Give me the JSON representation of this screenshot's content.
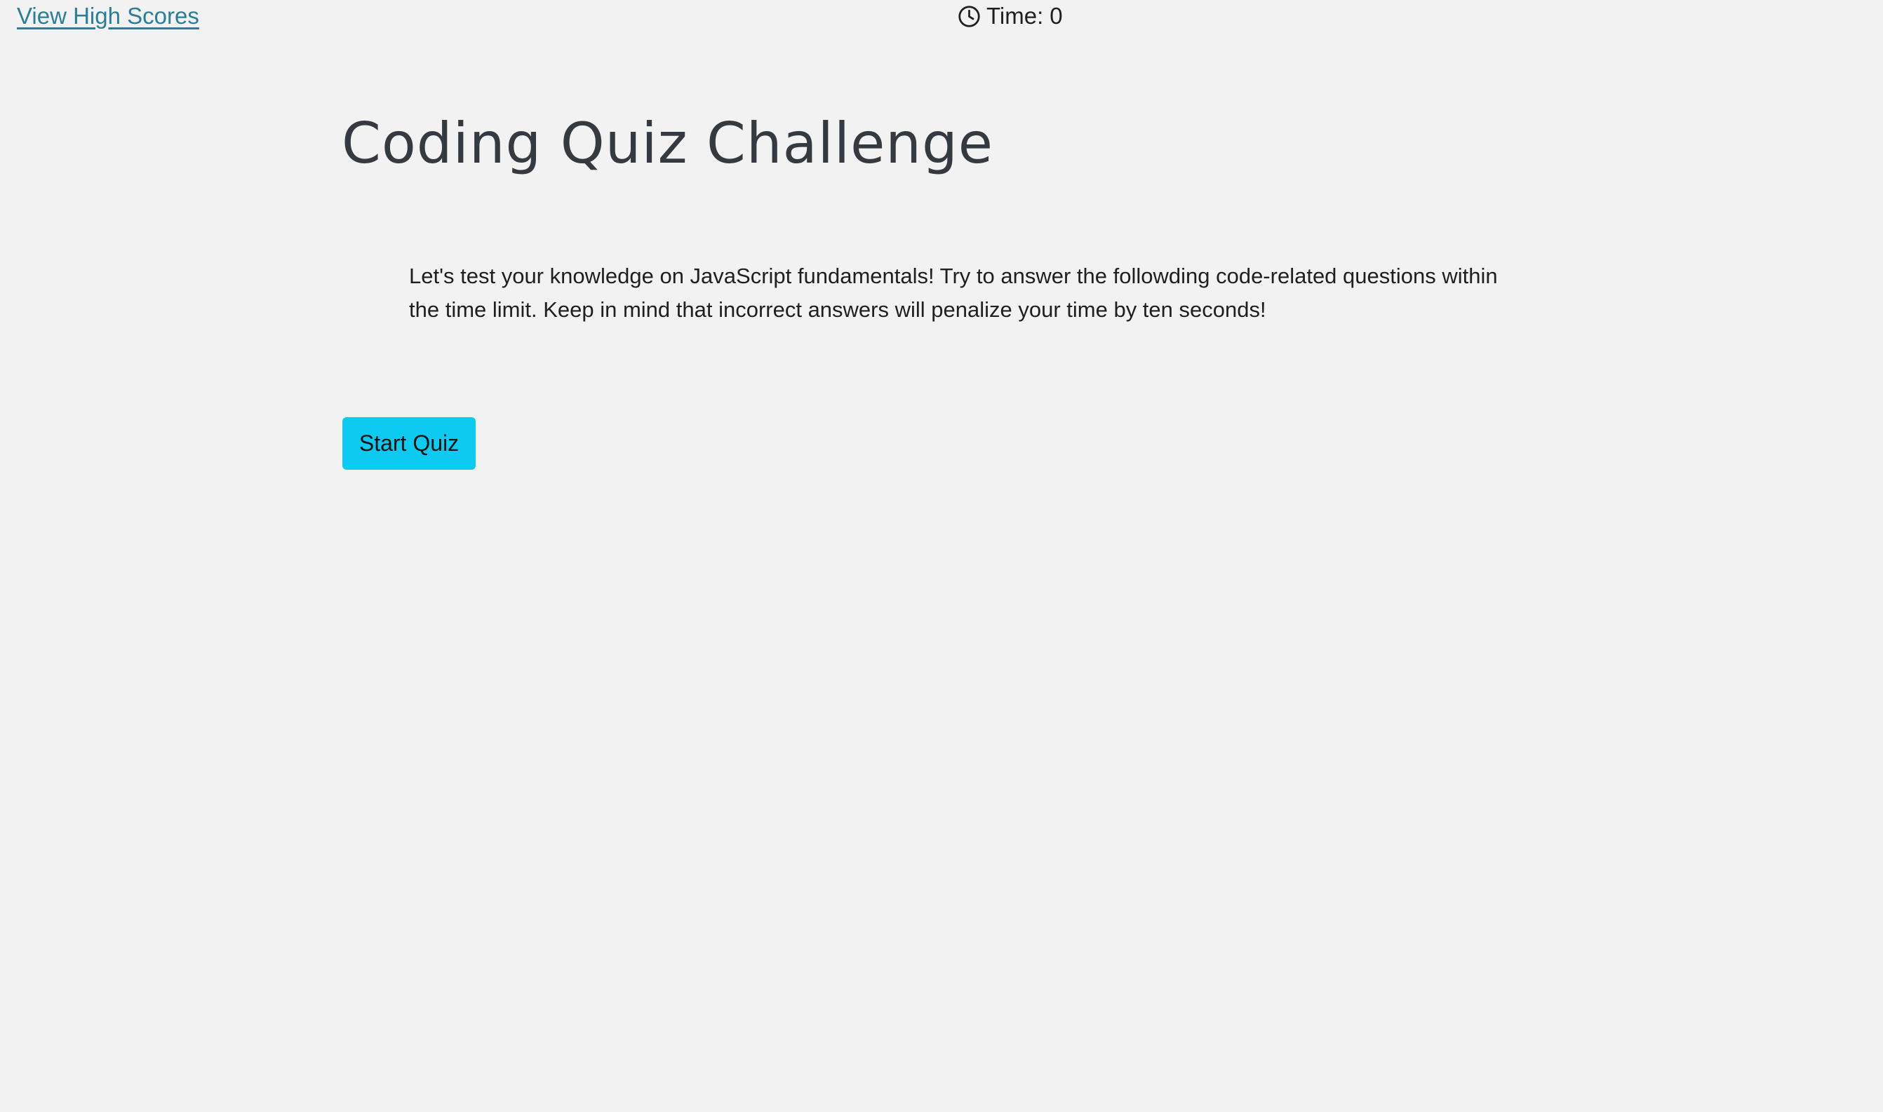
{
  "header": {
    "high_scores_link": "View High Scores",
    "timer": {
      "icon": "clock-icon",
      "label": "Time:",
      "value": "0"
    }
  },
  "main": {
    "title": "Coding Quiz Challenge",
    "description": "Let's test your knowledge on JavaScript fundamentals! Try to answer the followding code-related questions within the time limit. Keep in mind that incorrect answers will penalize your time by ten seconds!",
    "start_button_label": "Start Quiz"
  },
  "colors": {
    "background": "#f2f2f2",
    "link": "#2a7f96",
    "button": "#0dcaf0",
    "title": "#343a40"
  }
}
